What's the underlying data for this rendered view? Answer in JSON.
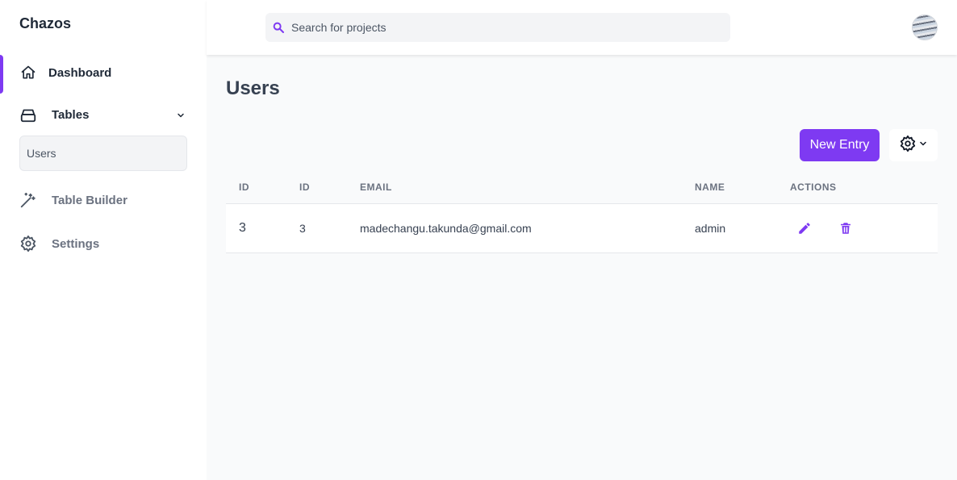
{
  "app": {
    "brand": "Chazos"
  },
  "sidebar": {
    "items": [
      {
        "label": "Dashboard",
        "icon": "home-icon"
      },
      {
        "label": "Tables",
        "icon": "tables-icon"
      },
      {
        "label": "Table Builder",
        "icon": "magic-wand-icon"
      },
      {
        "label": "Settings",
        "icon": "gear-icon"
      }
    ],
    "submenu": [
      {
        "label": "Users"
      }
    ]
  },
  "header": {
    "search": {
      "placeholder": "Search for projects",
      "value": ""
    }
  },
  "main": {
    "title": "Users",
    "new_entry_label": "New Entry",
    "table": {
      "headers": [
        "ID",
        "ID",
        "EMAIL",
        "NAME",
        "ACTIONS"
      ],
      "rows": [
        {
          "id1": "3",
          "id2": "3",
          "email": "madechangu.takunda@gmail.com",
          "name": "admin"
        }
      ]
    }
  },
  "colors": {
    "accent": "#7e3af2",
    "background": "#f9fafb",
    "text": "#374151"
  }
}
